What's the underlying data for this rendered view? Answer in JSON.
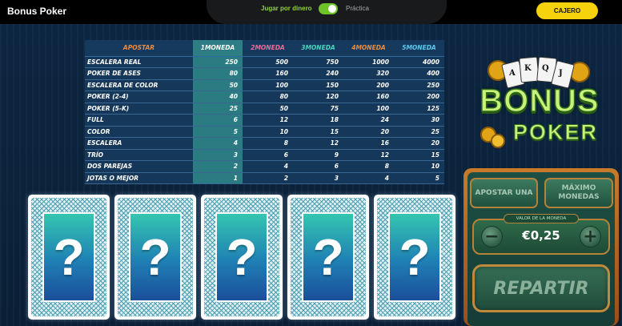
{
  "header": {
    "title": "Bonus Poker",
    "mode_real": "Jugar por dinero",
    "mode_practice": "Práctica",
    "cashier": "CAJERO"
  },
  "paytable": {
    "headers": [
      "APOSTAR",
      "1MONEDA",
      "2MONEDA",
      "3MONEDA",
      "4MONEDA",
      "5MONEDA"
    ],
    "rows": [
      {
        "hand": "ESCALERA REAL",
        "pays": [
          "250",
          "500",
          "750",
          "1000",
          "4000"
        ]
      },
      {
        "hand": "POKER DE ASES",
        "pays": [
          "80",
          "160",
          "240",
          "320",
          "400"
        ]
      },
      {
        "hand": "ESCALERA DE COLOR",
        "pays": [
          "50",
          "100",
          "150",
          "200",
          "250"
        ]
      },
      {
        "hand": "POKER (2-4)",
        "pays": [
          "40",
          "80",
          "120",
          "160",
          "200"
        ]
      },
      {
        "hand": "POKER (5-K)",
        "pays": [
          "25",
          "50",
          "75",
          "100",
          "125"
        ]
      },
      {
        "hand": "FULL",
        "pays": [
          "6",
          "12",
          "18",
          "24",
          "30"
        ]
      },
      {
        "hand": "COLOR",
        "pays": [
          "5",
          "10",
          "15",
          "20",
          "25"
        ]
      },
      {
        "hand": "ESCALERA",
        "pays": [
          "4",
          "8",
          "12",
          "16",
          "20"
        ]
      },
      {
        "hand": "TRÍO",
        "pays": [
          "3",
          "6",
          "9",
          "12",
          "15"
        ]
      },
      {
        "hand": "DOS PAREJAS",
        "pays": [
          "2",
          "4",
          "6",
          "8",
          "10"
        ]
      },
      {
        "hand": "JOTAS O MEJOR",
        "pays": [
          "1",
          "2",
          "3",
          "4",
          "5"
        ]
      }
    ]
  },
  "cards": [
    {
      "face": "?"
    },
    {
      "face": "?"
    },
    {
      "face": "?"
    },
    {
      "face": "?"
    },
    {
      "face": "?"
    }
  ],
  "logo": {
    "line1": "BONUS",
    "line2": "POKER",
    "playing_card_letters": [
      "A",
      "K",
      "Q",
      "J"
    ]
  },
  "controls": {
    "bet_one": "APOSTAR UNA",
    "max_line1": "MÁXIMO",
    "max_line2": "MONEDAS",
    "coin_value_label": "VALOR DE LA MONEDA",
    "coin_value": "€0,25",
    "minus": "−",
    "plus": "+",
    "deal": "REPARTIR"
  },
  "colors": {
    "accent_yellow": "#f6d20d",
    "toggle_green": "#6ec22a",
    "table_bg": "#15375a",
    "highlight_col": "#2b7b82",
    "panel_border": "#c87a2a"
  }
}
